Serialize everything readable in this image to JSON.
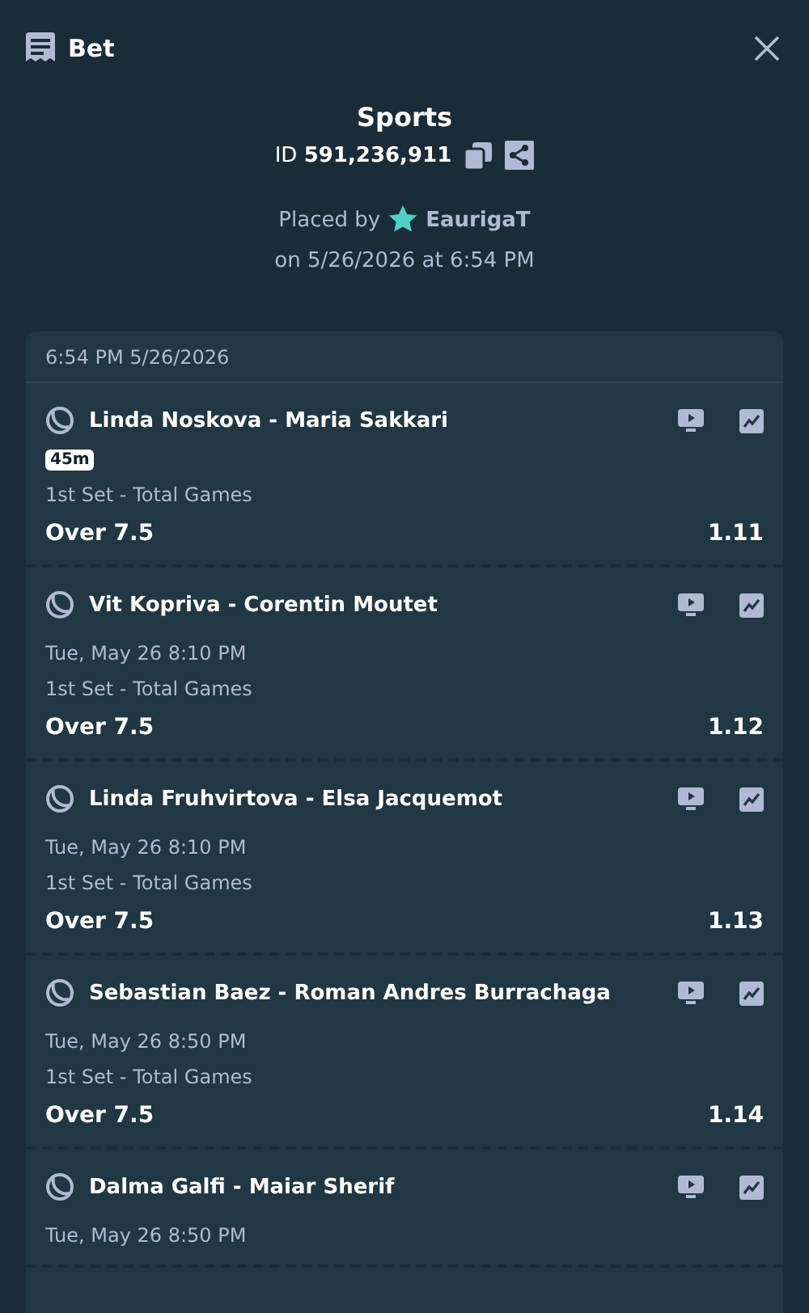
{
  "header": {
    "title": "Bet"
  },
  "summary": {
    "category": "Sports",
    "id_label": "ID",
    "id_value": "591,236,911",
    "placed_by_label": "Placed by",
    "user": "EaurigaT",
    "placed_on": "on 5/26/2026 at 6:54 PM"
  },
  "slip": {
    "timestamp": "6:54 PM 5/26/2026",
    "legs": [
      {
        "kind": "live",
        "event": "Linda Noskova - Maria Sakkari",
        "badge": "45m",
        "market": "1st Set - Total Games",
        "selection": "Over 7.5",
        "odds": "1.11"
      },
      {
        "kind": "scheduled",
        "event": "Vit Kopriva - Corentin Moutet",
        "start": "Tue, May 26  8:10 PM",
        "market": "1st Set - Total Games",
        "selection": "Over 7.5",
        "odds": "1.12"
      },
      {
        "kind": "scheduled",
        "event": "Linda Fruhvirtova - Elsa Jacquemot",
        "start": "Tue, May 26  8:10 PM",
        "market": "1st Set - Total Games",
        "selection": "Over 7.5",
        "odds": "1.13"
      },
      {
        "kind": "scheduled",
        "event": "Sebastian Baez - Roman Andres Burrachaga",
        "start": "Tue, May 26  8:50 PM",
        "market": "1st Set - Total Games",
        "selection": "Over 7.5",
        "odds": "1.14"
      },
      {
        "kind": "scheduled",
        "event": "Dalma Galfi - Maiar Sherif",
        "start": "Tue, May 26  8:50 PM"
      }
    ]
  }
}
